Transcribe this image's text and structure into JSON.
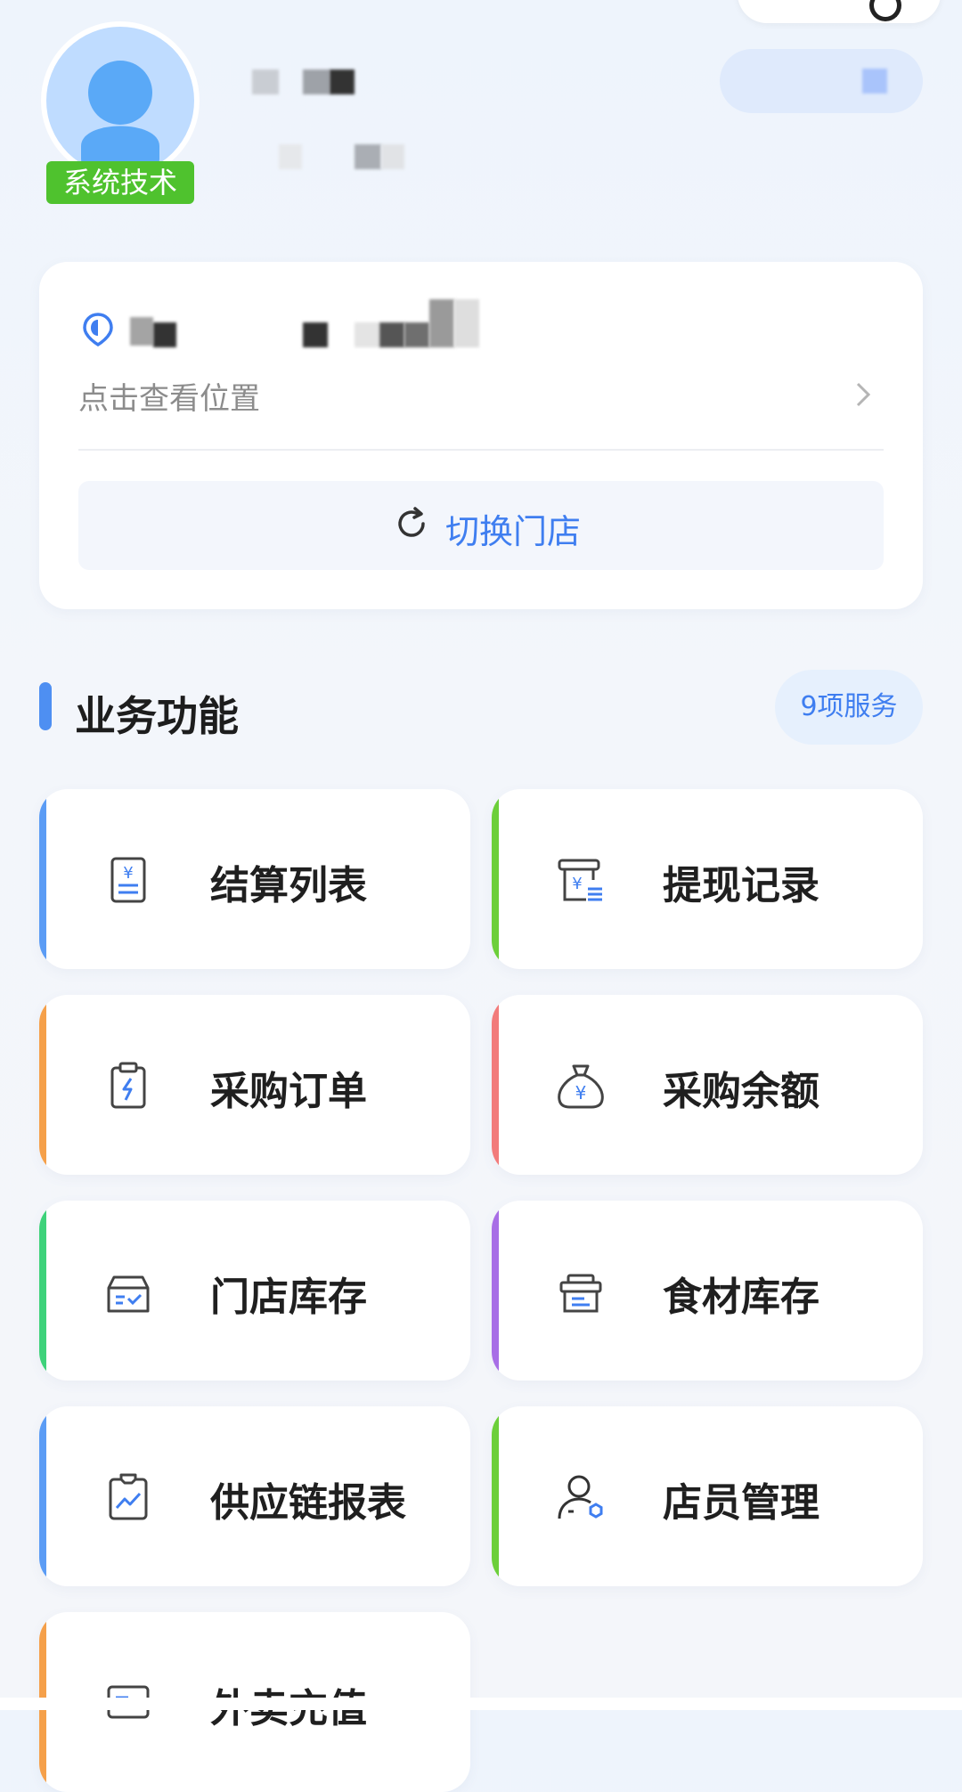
{
  "header": {
    "role_badge": "系统技术"
  },
  "store": {
    "location_hint": "点击查看位置",
    "switch_label": "切换门店"
  },
  "section": {
    "title": "业务功能",
    "count": "9项服务"
  },
  "functions": [
    {
      "label": "结算列表",
      "icon": "settlement-list-icon",
      "accent": "#5b9cf5"
    },
    {
      "label": "提现记录",
      "icon": "withdraw-record-icon",
      "accent": "#6ccf3a"
    },
    {
      "label": "采购订单",
      "icon": "purchase-order-icon",
      "accent": "#f5a04a"
    },
    {
      "label": "采购余额",
      "icon": "money-bag-icon",
      "accent": "#f27b7b"
    },
    {
      "label": "门店库存",
      "icon": "store-inventory-icon",
      "accent": "#3ed27a"
    },
    {
      "label": "食材库存",
      "icon": "ingredient-inventory-icon",
      "accent": "#a86ee6"
    },
    {
      "label": "供应链报表",
      "icon": "supply-chain-report-icon",
      "accent": "#5b9cf5"
    },
    {
      "label": "店员管理",
      "icon": "staff-management-icon",
      "accent": "#6ccf3a"
    },
    {
      "label": "外卖充值",
      "icon": "takeout-recharge-icon",
      "accent": "#f5a04a"
    }
  ],
  "colors": {
    "primary": "#3f7ef0",
    "badge_green": "#4fc22e",
    "text_dark": "#1f1f1f",
    "hint_gray": "#8c8c8c"
  }
}
